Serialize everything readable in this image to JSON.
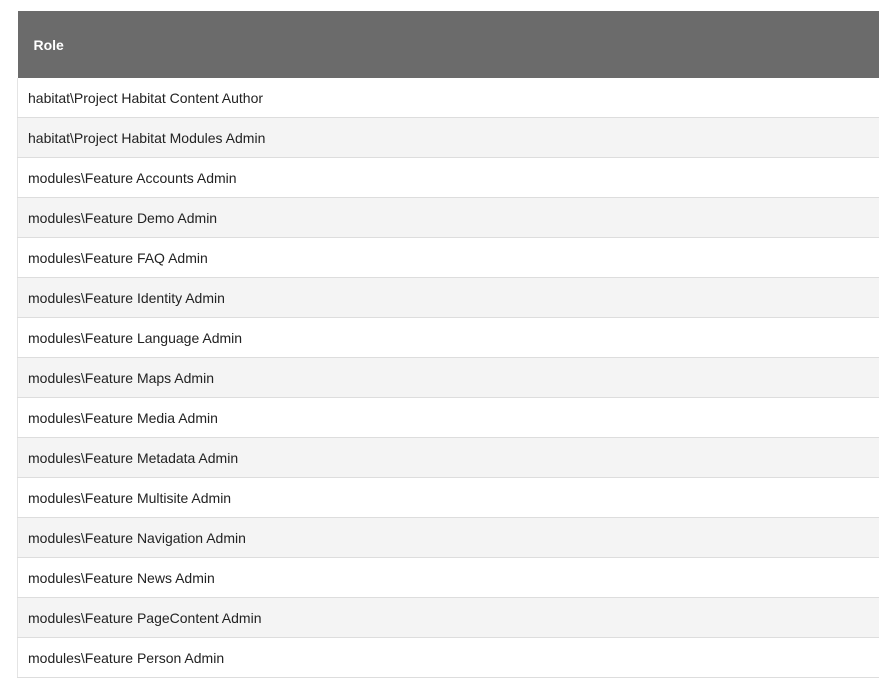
{
  "table": {
    "header": "Role",
    "rows": [
      "habitat\\Project Habitat Content Author",
      "habitat\\Project Habitat Modules Admin",
      "modules\\Feature Accounts Admin",
      "modules\\Feature Demo Admin",
      "modules\\Feature FAQ Admin",
      "modules\\Feature Identity Admin",
      "modules\\Feature Language Admin",
      "modules\\Feature Maps Admin",
      "modules\\Feature Media Admin",
      "modules\\Feature Metadata Admin",
      "modules\\Feature Multisite Admin",
      "modules\\Feature Navigation Admin",
      "modules\\Feature News Admin",
      "modules\\Feature PageContent Admin",
      "modules\\Feature Person Admin"
    ]
  },
  "colors": {
    "header_bg": "#6b6b6b",
    "header_text": "#ffffff",
    "row_alt_bg": "#f4f4f4",
    "row_border": "#dddddd"
  }
}
